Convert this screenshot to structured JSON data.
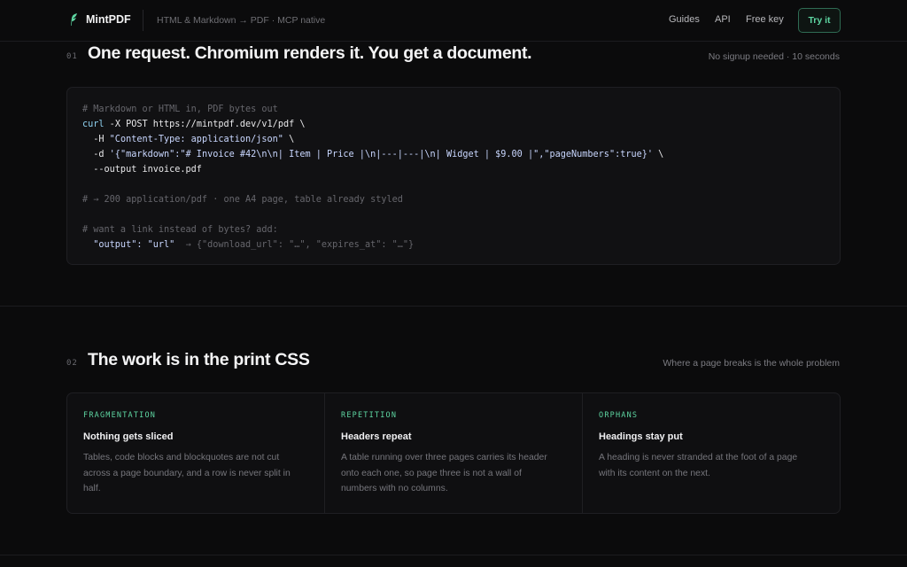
{
  "nav": {
    "brand": "MintPDF",
    "tagline": "HTML & Markdown → PDF · MCP native",
    "links": [
      "Guides",
      "API",
      "Free key"
    ],
    "cta": "Try it",
    "brand_color": "#5ed6a2"
  },
  "section1": {
    "number": "01",
    "title": "One request. Chromium renders it. You get a document.",
    "note": "No signup needed · 10 seconds",
    "code": {
      "l1": "# Markdown or HTML in, PDF bytes out",
      "l2a": "curl",
      "l2b": " -X POST https://mintpdf.dev/v1/pdf \\",
      "l3a": "  -H ",
      "l3b": "\"Content-Type: application/json\"",
      "l3c": " \\",
      "l4a": "  -d ",
      "l4b": "'{\"markdown\":\"# Invoice #42\\n\\n| Item | Price |\\n|---|---|\\n| Widget | $9.00 |\",\"pageNumbers\":true}'",
      "l4c": " \\",
      "l5": "  --output invoice.pdf",
      "l6": "# → 200 application/pdf · one A4 page, table already styled",
      "l7": "# want a link instead of bytes? add:",
      "l8a": "  \"output\": \"url\"",
      "l8b": "  → {\"download_url\": \"…\", \"expires_at\": \"…\"}"
    }
  },
  "section2": {
    "number": "02",
    "title": "The work is in the print CSS",
    "note": "Where a page breaks is the whole problem",
    "features": [
      {
        "tag": "FRAGMENTATION",
        "title": "Nothing gets sliced",
        "body": "Tables, code blocks and blockquotes are not cut across a page boundary, and a row is never split in half."
      },
      {
        "tag": "REPETITION",
        "title": "Headers repeat",
        "body": "A table running over three pages carries its header onto each one, so page three is not a wall of numbers with no columns."
      },
      {
        "tag": "ORPHANS",
        "title": "Headings stay put",
        "body": "A heading is never stranded at the foot of a page with its content on the next."
      }
    ]
  }
}
